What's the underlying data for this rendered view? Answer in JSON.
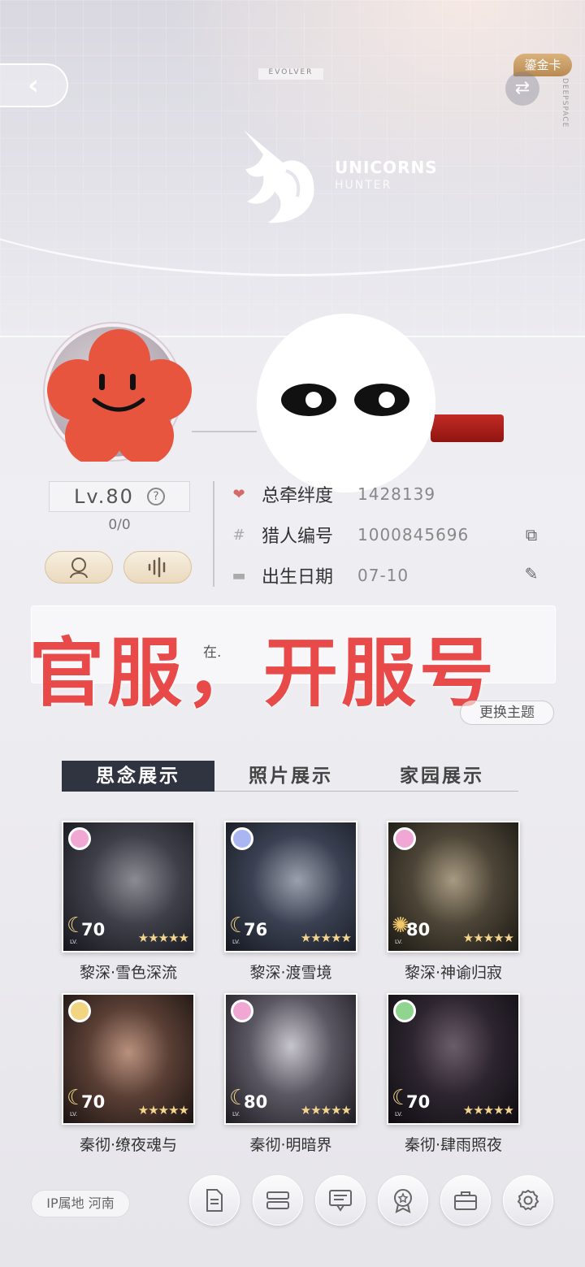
{
  "banner": {
    "badge": "EVOLVER",
    "logo_title": "UNICORNS",
    "logo_subtitle": "HUNTER",
    "card_label": "鎏金卡",
    "side_text": "DEEPSPACE"
  },
  "profile": {
    "level": "Lv.80",
    "exp": "0/0",
    "bond_label": "总牵绊度",
    "bond_value": "1428139",
    "hunter_id_label": "猎人编号",
    "hunter_id_value": "1000845696",
    "birthday_label": "出生日期",
    "birthday_value": "07-10"
  },
  "signature": {
    "text": "在.",
    "overlay": "官服，开服号"
  },
  "theme_button": "更换主题",
  "tabs": [
    "思念展示",
    "照片展示",
    "家园展示"
  ],
  "cards": [
    {
      "name": "黎深·雪色深流",
      "level": "70",
      "gem_color": "#f0a7d4",
      "icon": "moon-icon"
    },
    {
      "name": "黎深·渡雪境",
      "level": "76",
      "gem_color": "#a9b6f2",
      "icon": "moon-icon"
    },
    {
      "name": "黎深·神谕归寂",
      "level": "80",
      "gem_color": "#f0a7d4",
      "icon": "sun-icon"
    },
    {
      "name": "秦彻·缭夜魂与",
      "level": "70",
      "gem_color": "#f2d580",
      "icon": "moon-icon"
    },
    {
      "name": "秦彻·明暗界",
      "level": "80",
      "gem_color": "#f0a7d4",
      "icon": "moon-icon"
    },
    {
      "name": "秦彻·肆雨照夜",
      "level": "70",
      "gem_color": "#8fd58f",
      "icon": "moon-icon"
    }
  ],
  "card_lv_tag": "LV.",
  "card_stars": "★★★★★",
  "footer": {
    "ip_location": "IP属地 河南"
  }
}
